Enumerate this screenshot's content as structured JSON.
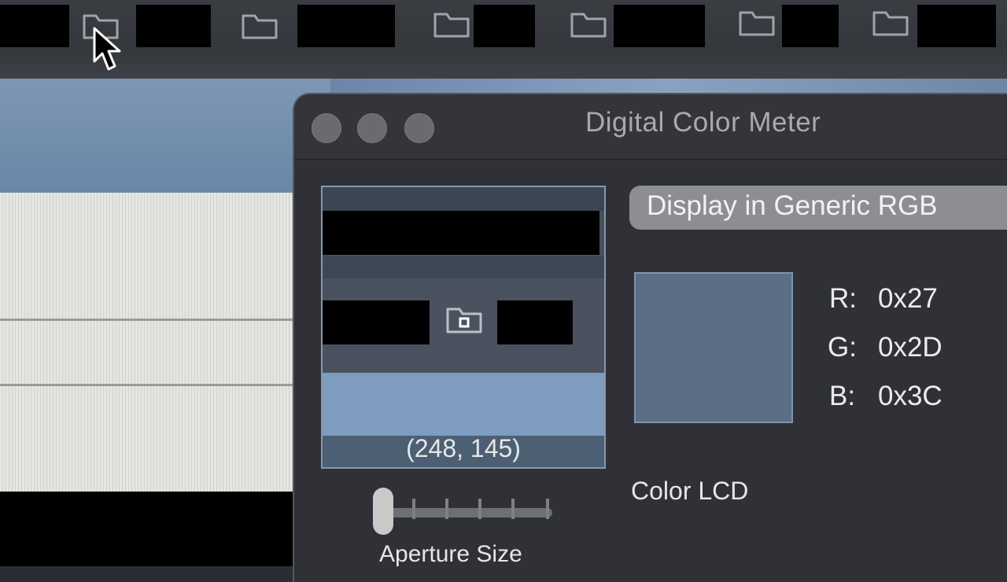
{
  "window": {
    "title": "Digital Color Meter"
  },
  "topbar": {
    "folder_icons": [
      "folder-icon",
      "folder-icon",
      "folder-icon",
      "folder-icon",
      "folder-icon",
      "folder-icon"
    ]
  },
  "magnifier": {
    "coordinates": "(248, 145)"
  },
  "display_popup": {
    "selected": "Display in Generic RGB"
  },
  "color": {
    "r_label": "R:",
    "r_value": "0x27",
    "g_label": "G:",
    "g_value": "0x2D",
    "b_label": "B:",
    "b_value": "0x3C",
    "swatch_hex": "#5c6d86"
  },
  "profile": {
    "name": "Color LCD"
  },
  "aperture": {
    "label": "Aperture Size",
    "level": 0
  },
  "colors": {
    "window_bg": "#2f3137",
    "titlebar_bg": "#33353b",
    "desktop_blue": "#7d97b5"
  }
}
